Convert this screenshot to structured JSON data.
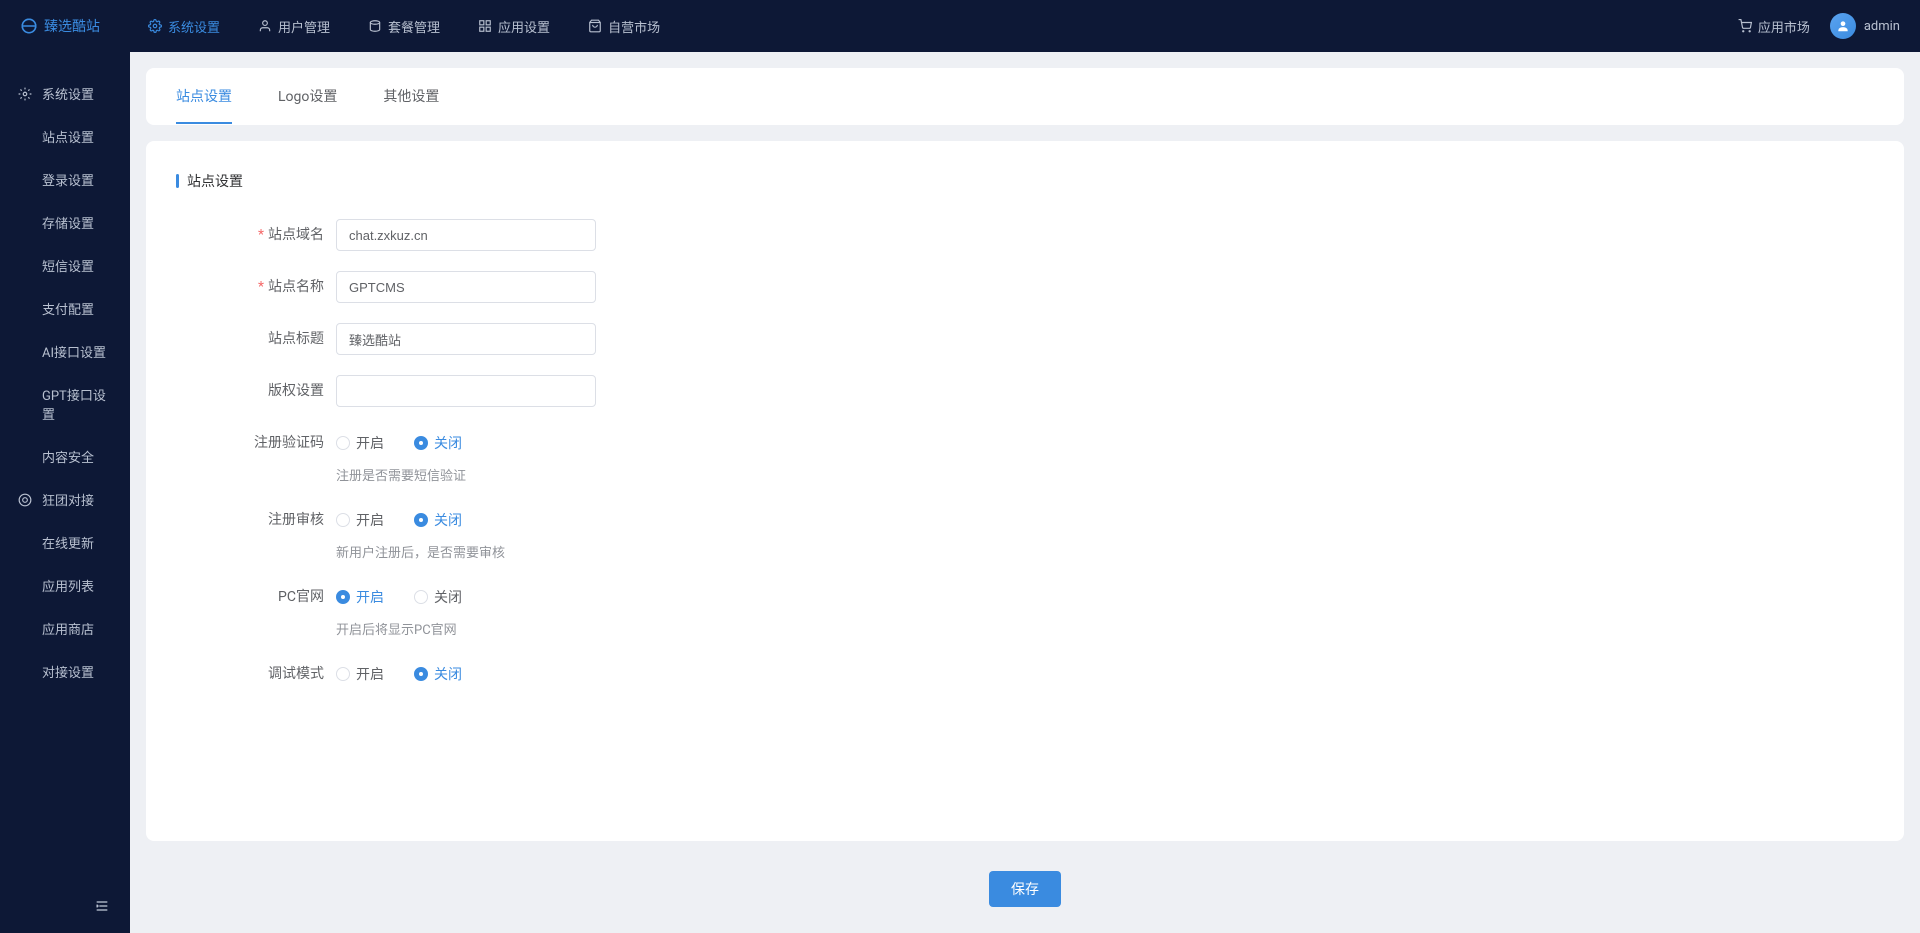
{
  "header": {
    "logo": "臻选酷站",
    "nav": [
      {
        "label": "系统设置",
        "icon": "gear",
        "active": true
      },
      {
        "label": "用户管理",
        "icon": "user"
      },
      {
        "label": "套餐管理",
        "icon": "package"
      },
      {
        "label": "应用设置",
        "icon": "grid"
      },
      {
        "label": "自营市场",
        "icon": "bag"
      }
    ],
    "market_link": "应用市场",
    "username": "admin"
  },
  "sidebar": {
    "groups": [
      {
        "label": "系统设置",
        "icon": "gear",
        "items": [
          {
            "label": "站点设置"
          },
          {
            "label": "登录设置"
          },
          {
            "label": "存储设置"
          },
          {
            "label": "短信设置"
          },
          {
            "label": "支付配置"
          },
          {
            "label": "AI接口设置"
          },
          {
            "label": "GPT接口设置"
          },
          {
            "label": "内容安全"
          }
        ]
      },
      {
        "label": "狂团对接",
        "icon": "link",
        "items": [
          {
            "label": "在线更新"
          },
          {
            "label": "应用列表"
          },
          {
            "label": "应用商店"
          },
          {
            "label": "对接设置"
          }
        ]
      }
    ]
  },
  "tabs": [
    {
      "label": "站点设置",
      "active": true
    },
    {
      "label": "Logo设置"
    },
    {
      "label": "其他设置"
    }
  ],
  "section_title": "站点设置",
  "form": {
    "site_domain": {
      "label": "站点域名",
      "value": "chat.zxkuz.cn",
      "required": true
    },
    "site_name": {
      "label": "站点名称",
      "value": "GPTCMS",
      "required": true
    },
    "site_title": {
      "label": "站点标题",
      "value": "臻选酷站"
    },
    "copyright": {
      "label": "版权设置",
      "value": ""
    },
    "register_captcha": {
      "label": "注册验证码",
      "on": "开启",
      "off": "关闭",
      "value": "off",
      "hint": "注册是否需要短信验证"
    },
    "register_review": {
      "label": "注册审核",
      "on": "开启",
      "off": "关闭",
      "value": "off",
      "hint": "新用户注册后，是否需要审核"
    },
    "pc_site": {
      "label": "PC官网",
      "on": "开启",
      "off": "关闭",
      "value": "on",
      "hint": "开启后将显示PC官网"
    },
    "debug_mode": {
      "label": "调试模式",
      "on": "开启",
      "off": "关闭",
      "value": "off"
    }
  },
  "save_button": "保存"
}
